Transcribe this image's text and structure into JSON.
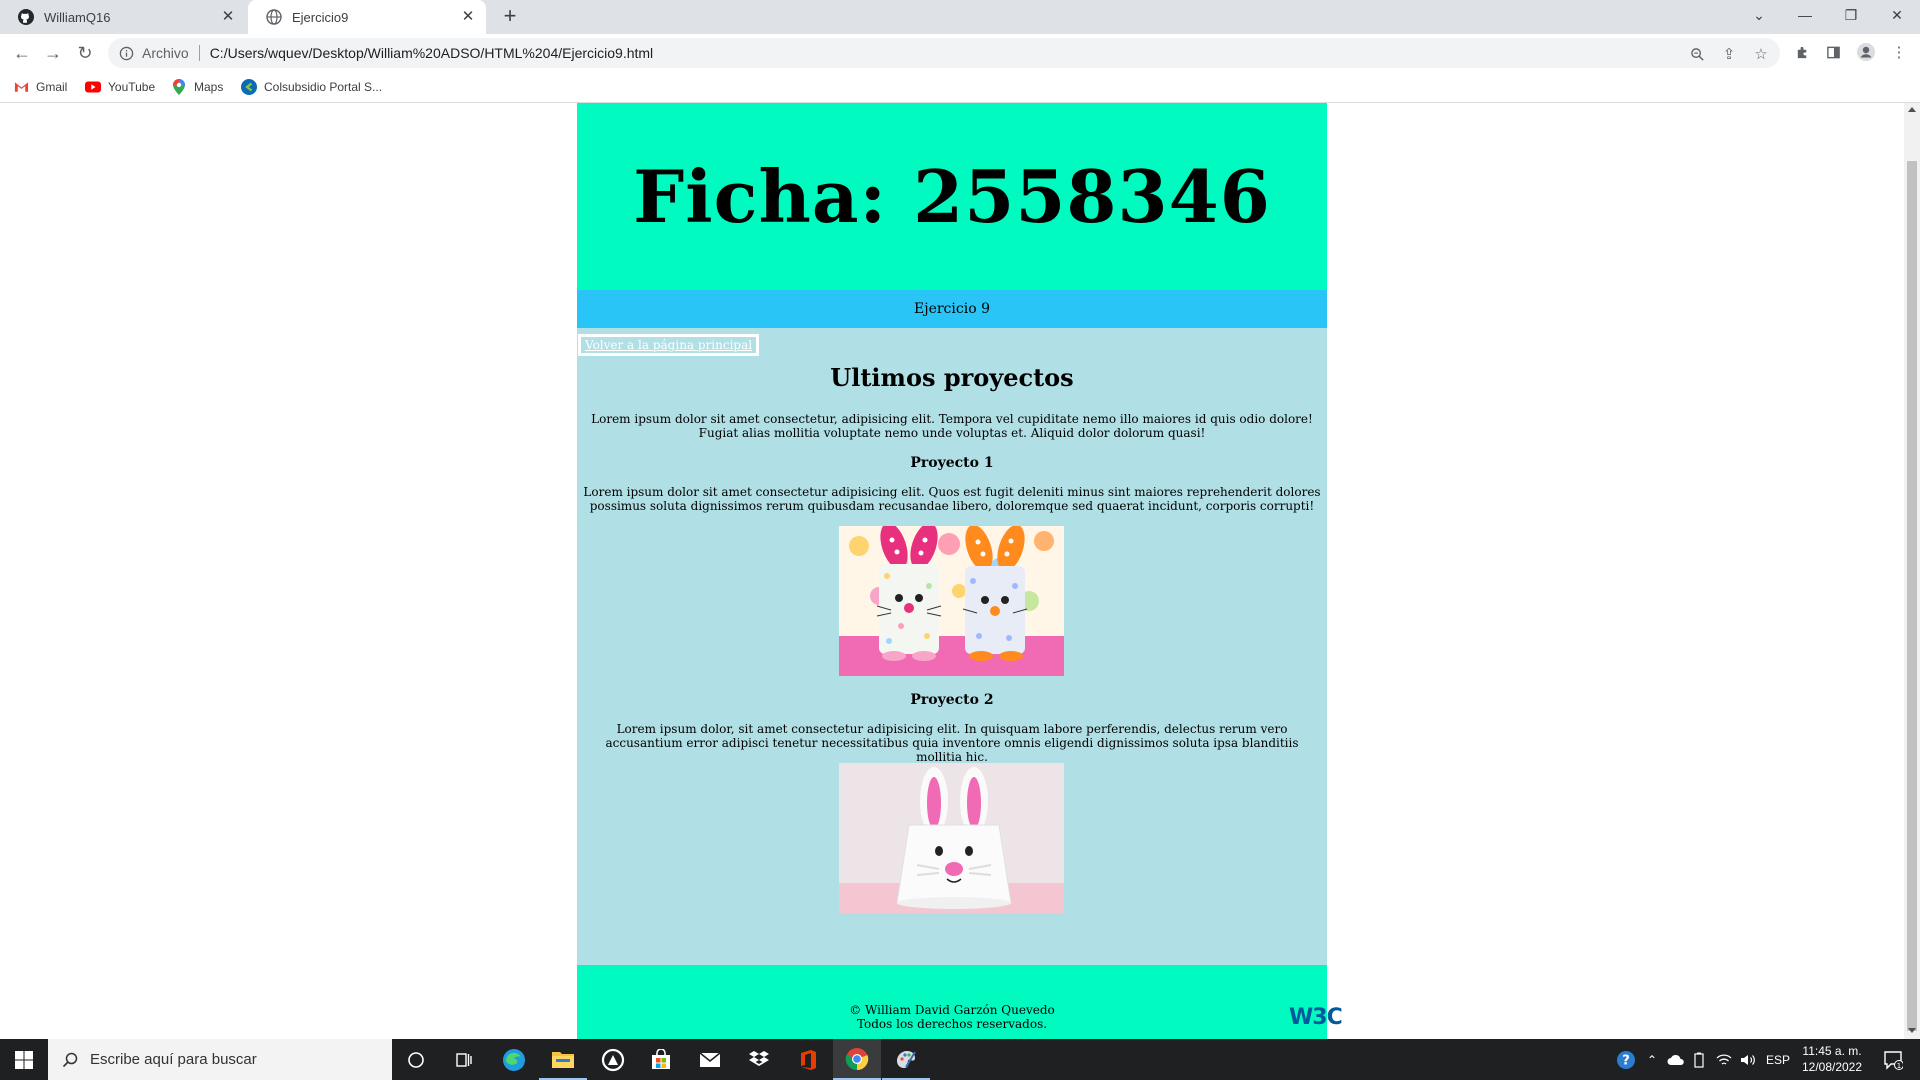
{
  "browser": {
    "tabs": [
      {
        "title": "WilliamQ16",
        "active": false,
        "favicon": "github-icon"
      },
      {
        "title": "Ejercicio9",
        "active": true,
        "favicon": "globe-icon"
      }
    ],
    "omnibox": {
      "security_label": "Archivo",
      "url": "C:/Users/wquev/Desktop/William%20ADSO/HTML%204/Ejercicio9.html"
    },
    "bookmarks": [
      {
        "label": "Gmail",
        "icon": "gmail-icon"
      },
      {
        "label": "YouTube",
        "icon": "youtube-icon"
      },
      {
        "label": "Maps",
        "icon": "maps-icon"
      },
      {
        "label": "Colsubsidio Portal S...",
        "icon": "colsubsidio-icon"
      }
    ]
  },
  "page": {
    "title": "Ficha: 2558346",
    "subheader": "Ejercicio 9",
    "back_link": "Volver a la página principal",
    "section_title": "Ultimos proyectos",
    "intro": "Lorem ipsum dolor sit amet consectetur, adipisicing elit. Tempora vel cupiditate nemo illo maiores id quis odio dolore! Fugiat alias mollitia voluptate nemo unde voluptas et. Aliquid dolor dolorum quasi!",
    "projects": [
      {
        "title": "Proyecto 1",
        "text": "Lorem ipsum dolor sit amet consectetur adipisicing elit. Quos est fugit deleniti minus sint maiores reprehenderit dolores possimus soluta dignissimos rerum quibusdam recusandae libero, doloremque sed quaerat incidunt, corporis corrupti!",
        "image": "polka-dot bunny craft rolls"
      },
      {
        "title": "Proyecto 2",
        "text": "Lorem ipsum dolor, sit amet consectetur adipisicing elit. In quisquam labore perferendis, delectus rerum vero accusantium error adipisci tenetur necessitatibus quia inventore omnis eligendi dignissimos soluta ipsa blanditiis mollitia hic.",
        "image": "paper cup bunny craft"
      }
    ],
    "footer": {
      "line1": "© William David Garzón Quevedo",
      "line2": "Todos los derechos reservados.",
      "badge": "W3C"
    },
    "colors": {
      "header_bg": "#00fac0",
      "subheader_bg": "#29c5f6",
      "body_bg": "#b0dfe5"
    }
  },
  "taskbar": {
    "search_placeholder": "Escribe aquí para buscar",
    "apps": [
      "cortana-icon",
      "task-view-icon",
      "edge-icon",
      "file-explorer-icon",
      "app-icon",
      "store-icon",
      "mail-icon",
      "dropbox-icon",
      "office-icon",
      "chrome-icon",
      "paint-icon"
    ],
    "language": "ESP",
    "time": "11:45 a. m.",
    "date": "12/08/2022",
    "notification_count": "1"
  }
}
